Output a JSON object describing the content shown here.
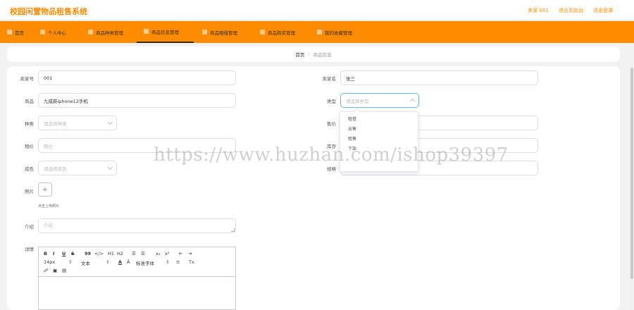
{
  "app": {
    "title": "校园闲置物品租售系统"
  },
  "top_links": [
    "卖家 001",
    "退出到前台",
    "退出登录"
  ],
  "nav": [
    "首页",
    "个人中心",
    "商品种类管理",
    "商品信息管理",
    "商品租借管理",
    "商品购买管理",
    "我的收藏管理"
  ],
  "breadcrumb": {
    "home": "首页",
    "sep": "/",
    "current": "商品信息"
  },
  "form": {
    "seller_id": {
      "label": "卖家号",
      "value": "001"
    },
    "seller_name": {
      "label": "卖家名",
      "value": "张三"
    },
    "product": {
      "label": "商品",
      "value": "九成新iphone12手机"
    },
    "type": {
      "label": "类型",
      "placeholder": "请选择类型"
    },
    "category": {
      "label": "种类",
      "placeholder": "请选择种类"
    },
    "price": {
      "label": "售价"
    },
    "rent": {
      "label": "租价",
      "placeholder": "租价"
    },
    "stock": {
      "label": "库存"
    },
    "condition": {
      "label": "成色",
      "placeholder": "请选择成色"
    },
    "spec": {
      "label": "规格",
      "placeholder": "规格"
    },
    "image": {
      "label": "照片",
      "tip": "点击上传照片"
    },
    "intro": {
      "label": "介绍",
      "placeholder": "介绍"
    },
    "detail": {
      "label": "详情"
    }
  },
  "type_options": [
    "租借",
    "出售",
    "租售",
    "下架"
  ],
  "editor": {
    "row1": [
      "B",
      "I",
      "U",
      "S",
      "99",
      "</>",
      "H1",
      "H2",
      "☰",
      "☰",
      "x₂",
      "x²",
      "⇤",
      "⇥"
    ],
    "font_size": "14px",
    "text": "文本",
    "font": "标准字体",
    "row2_icons": [
      "A",
      "Ā",
      "≡",
      "Tx"
    ]
  },
  "watermark": "https://www.huzhan.com/ishop39397",
  "colors": {
    "accent": "#ff8c00",
    "nav_text": "#3a2a10",
    "focus": "#6bb7d8"
  }
}
